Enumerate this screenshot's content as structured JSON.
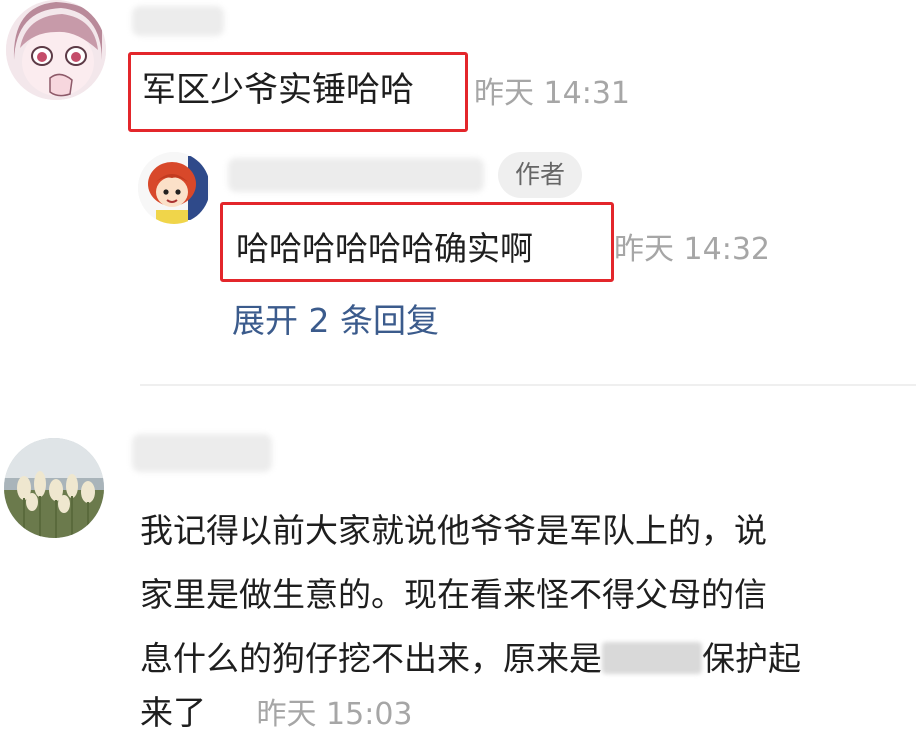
{
  "comments": [
    {
      "text": "军区少爷实锤哈哈",
      "time": "昨天 14:31"
    },
    {
      "badge": "作者",
      "text": "哈哈哈哈哈哈确实啊",
      "time": "昨天 14:32",
      "expand_replies": "展开 2 条回复"
    },
    {
      "lines": [
        "我记得以前大家就说他爷爷是军队上的，说",
        "家里是做生意的。现在看来怪不得父母的信",
        "息什么的狗仔挖不出来，原来是",
        "保护起",
        "来了"
      ],
      "time": "昨天 15:03"
    }
  ],
  "colors": {
    "highlight": "#e3262b",
    "link": "#3b5b8c",
    "timestamp": "#a6a6a6"
  },
  "icons": [
    "girl-cartoon-avatar",
    "redhead-cartoon-avatar",
    "reed-landscape-avatar"
  ]
}
